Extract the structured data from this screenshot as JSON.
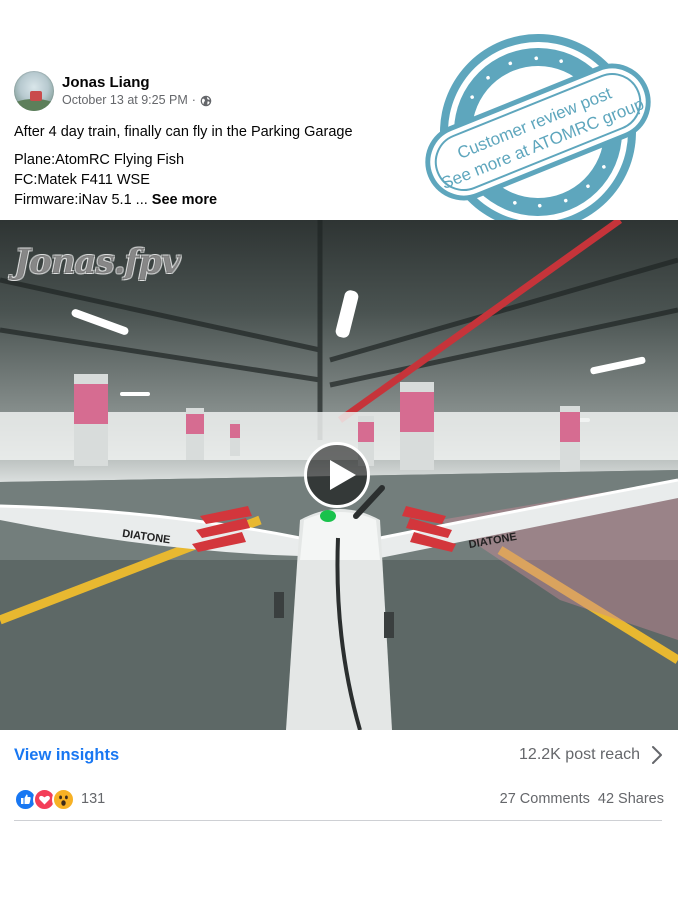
{
  "post": {
    "author": "Jonas Liang",
    "timestamp": "October 13 at 9:25 PM",
    "separator": "·",
    "privacy_icon": "globe-icon",
    "text_line1": "After 4 day train, finally can fly in the Parking Garage",
    "text_line2": "Plane:AtomRC Flying Fish",
    "text_line3": "FC:Matek F411 WSE",
    "text_line4": "Firmware:iNav 5.1",
    "ellipsis": "...",
    "see_more": "See more"
  },
  "stamp": {
    "line1": "Customer review post",
    "line2": "See more at ATOMRC group",
    "color": "#5ea6bd"
  },
  "video": {
    "watermark": "Jonas.fpv",
    "wing_brand_left": "DIATONE",
    "wing_brand_right": "DIATONE",
    "play_icon": "play-icon"
  },
  "insights": {
    "view_label": "View insights",
    "reach_label": "12.2K post reach"
  },
  "engagement": {
    "reaction_icons": [
      "like-icon",
      "love-icon",
      "wow-icon"
    ],
    "reaction_count": "131",
    "comments": "27 Comments",
    "shares": "42 Shares"
  },
  "colors": {
    "link": "#1877f2",
    "secondary_text": "#65676b",
    "like": "#1877f2",
    "love": "#f33e58",
    "wow": "#f7b125"
  }
}
